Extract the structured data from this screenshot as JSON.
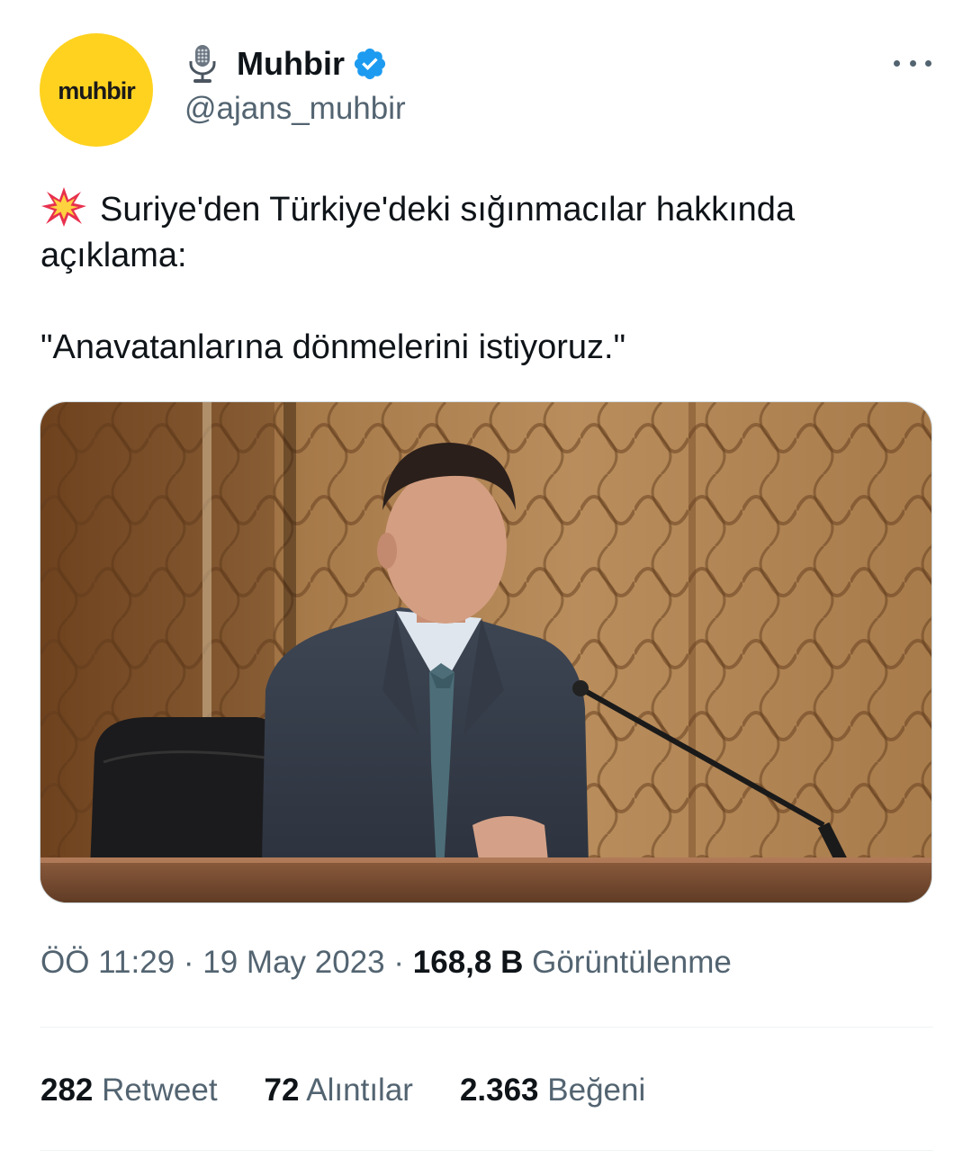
{
  "author": {
    "avatar_text": "muhbir",
    "avatar_color": "#ffd21f",
    "display_name": "Muhbir",
    "handle": "@ajans_muhbir",
    "name_prefix_icon": "studio-microphone-icon",
    "verified_icon": "verified-badge-icon",
    "verified_color": "#1d9bf0"
  },
  "more_menu_icon": "more-dots-icon",
  "tweet": {
    "emoji_icon": "collision-icon",
    "line1": "Suriye'den Türkiye'deki sığınmacılar hakkında açıklama:",
    "quote": "\"Anavatanlarına dönmelerini istiyoruz.\""
  },
  "media": {
    "alt": "photo"
  },
  "meta": {
    "time": "ÖÖ 11:29",
    "sep1": " · ",
    "date": "19 May 2023",
    "sep2": " · ",
    "views_count": "168,8 B",
    "views_label": "Görüntülenme"
  },
  "stats": {
    "retweets_count": "282",
    "retweets_label": "Retweet",
    "quotes_count": "72",
    "quotes_label": "Alıntılar",
    "likes_count": "2.363",
    "likes_label": "Beğeni"
  },
  "colors": {
    "primary_text": "#0f1419",
    "secondary_text": "#536471",
    "divider": "#eff3f4"
  }
}
